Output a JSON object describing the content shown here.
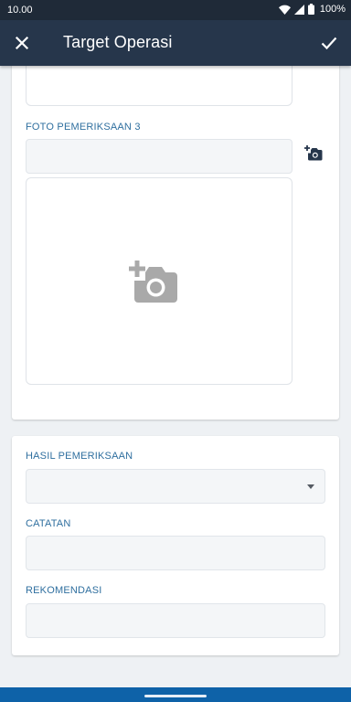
{
  "status_bar": {
    "time": "10.00",
    "battery": "100%",
    "icons": [
      "wifi-icon",
      "cellular-signal-icon",
      "battery-icon"
    ]
  },
  "app_bar": {
    "title": "Target Operasi",
    "left_icon": "close-icon",
    "right_icon": "check-icon"
  },
  "form": {
    "photo_section": {
      "label": "FOTO PEMERIKSAAN 3",
      "value": "",
      "add_icon": "add-camera-icon"
    },
    "result_section": {
      "hasil": {
        "label": "HASIL PEMERIKSAAN",
        "selected": ""
      },
      "catatan": {
        "label": "CATATAN",
        "value": ""
      },
      "rekomendasi": {
        "label": "REKOMENDASI",
        "value": ""
      }
    }
  },
  "colors": {
    "status_bar": "#1f2a38",
    "app_bar": "#26364b",
    "label": "#2f6f9f",
    "nav_bar": "#0e62a8",
    "background": "#eef1f4"
  }
}
